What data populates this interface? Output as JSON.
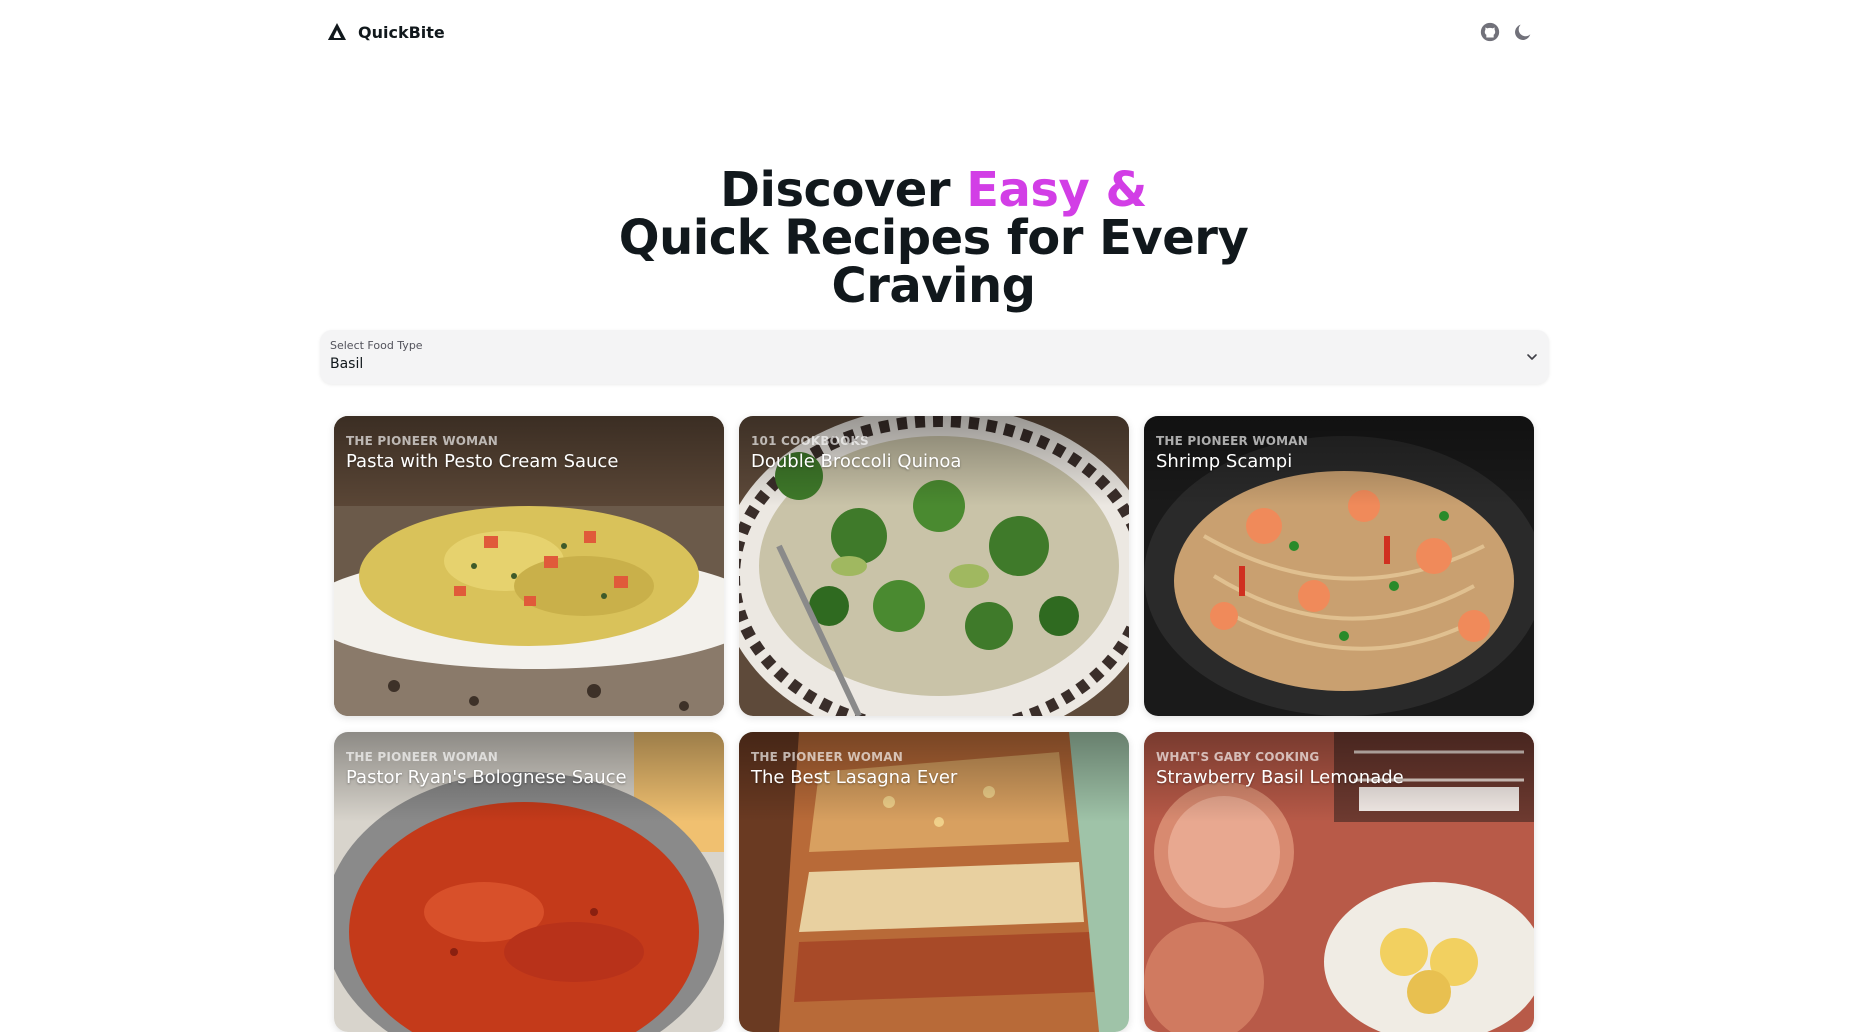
{
  "navbar": {
    "brand": "QuickBite",
    "github_icon": "github-icon",
    "theme_icon": "moon-icon"
  },
  "hero": {
    "line1_prefix": "Discover ",
    "line1_accent": "Easy &",
    "line2": "Quick Recipes for Every",
    "line3": "Craving",
    "accent_color": "#d23ee6"
  },
  "food_select": {
    "label": "Select Food Type",
    "value": "Basil"
  },
  "recipes": [
    {
      "source": "The Pioneer Woman",
      "title": "Pasta with Pesto Cream Sauce"
    },
    {
      "source": "101 Cookbooks",
      "title": "Double Broccoli Quinoa"
    },
    {
      "source": "The Pioneer Woman",
      "title": "Shrimp Scampi"
    },
    {
      "source": "The Pioneer Woman",
      "title": "Pastor Ryan's Bolognese Sauce"
    },
    {
      "source": "The Pioneer Woman",
      "title": "The Best Lasagna Ever"
    },
    {
      "source": "What's Gaby Cooking",
      "title": "Strawberry Basil Lemonade"
    }
  ]
}
